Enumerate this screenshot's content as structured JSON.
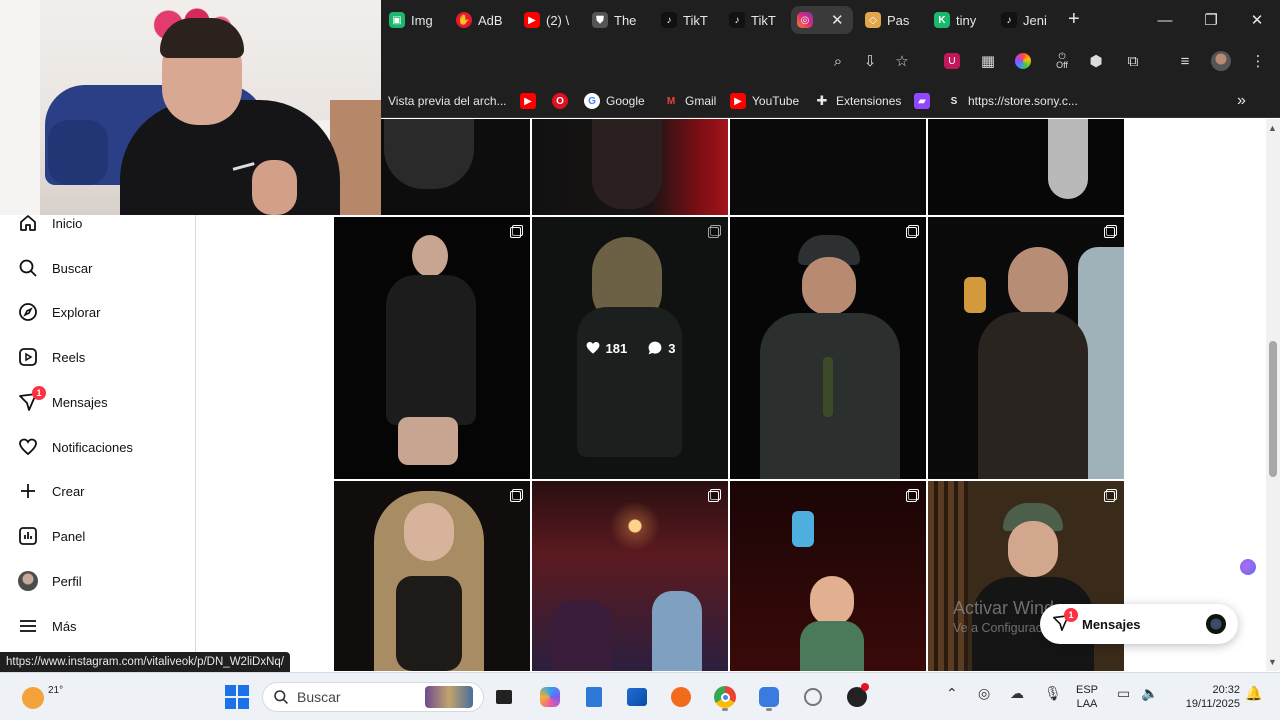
{
  "browser": {
    "tabs": [
      {
        "label": "Img",
        "icon": "imgur-icon",
        "color": "#1bb76e"
      },
      {
        "label": "AdB",
        "icon": "adblock-icon",
        "color": "#e8192c"
      },
      {
        "label": "(2) \\",
        "icon": "youtube-icon",
        "color": "#ff0000"
      },
      {
        "label": "The",
        "icon": "shield-icon",
        "color": "#555555"
      },
      {
        "label": "TikT",
        "icon": "tiktok-icon",
        "color": "#111111"
      },
      {
        "label": "TikT",
        "icon": "tiktok-icon",
        "color": "#111111"
      },
      {
        "label": "",
        "icon": "instagram-icon",
        "color": "#d62976",
        "active": true
      },
      {
        "label": "Pas",
        "icon": "ticket-icon",
        "color": "#e0a84a"
      },
      {
        "label": "tiny",
        "icon": "tiny-icon",
        "color": "#1bb76e"
      },
      {
        "label": "Jeni",
        "icon": "tiktok-icon",
        "color": "#111111"
      }
    ],
    "tab_close": "✕",
    "new_tab": "+",
    "window_controls": {
      "minimize": "—",
      "restore": "❐",
      "close": "✕"
    }
  },
  "bookmarks": [
    {
      "label": "Vista previa del arch...",
      "icon": ""
    },
    {
      "label": "",
      "icon": "youtube-icon"
    },
    {
      "label": "",
      "icon": "opera-icon"
    },
    {
      "label": "Google",
      "icon": "google-icon"
    },
    {
      "label": "Gmail",
      "icon": "gmail-icon"
    },
    {
      "label": "YouTube",
      "icon": "youtube-icon"
    },
    {
      "label": "Extensiones",
      "icon": "puzzle-icon"
    },
    {
      "label": "",
      "icon": "twitch-icon"
    },
    {
      "label": "https://store.sony.c...",
      "icon": "sony-icon"
    }
  ],
  "bookmarks_more": "»",
  "toolbar_off_label": "Off",
  "sidenav": {
    "items": [
      {
        "label": "Inicio",
        "icon": "home-icon"
      },
      {
        "label": "Buscar",
        "icon": "search-icon"
      },
      {
        "label": "Explorar",
        "icon": "compass-icon"
      },
      {
        "label": "Reels",
        "icon": "reels-icon"
      },
      {
        "label": "Mensajes",
        "icon": "messenger-icon",
        "badge": "1"
      },
      {
        "label": "Notificaciones",
        "icon": "heart-icon"
      },
      {
        "label": "Crear",
        "icon": "plus-icon"
      },
      {
        "label": "Panel",
        "icon": "chart-icon"
      },
      {
        "label": "Perfil",
        "icon": "avatar-icon"
      },
      {
        "label": "Más",
        "icon": "menu-icon"
      }
    ]
  },
  "grid": {
    "hover_post": {
      "likes": "181",
      "comments": "3"
    }
  },
  "status_url": "https://www.instagram.com/vitaliveok/p/DN_W2liDxNq/",
  "watermark": {
    "line1": "Activar Windows",
    "line2": "Ve a Configuración para activar Windows."
  },
  "messages_pill": {
    "label": "Mensajes",
    "badge": "1"
  },
  "taskbar": {
    "weather_temp": "21°",
    "search_placeholder": "Buscar",
    "lang_line1": "ESP",
    "lang_line2": "LAA",
    "time": "20:32",
    "date": "19/11/2025"
  }
}
